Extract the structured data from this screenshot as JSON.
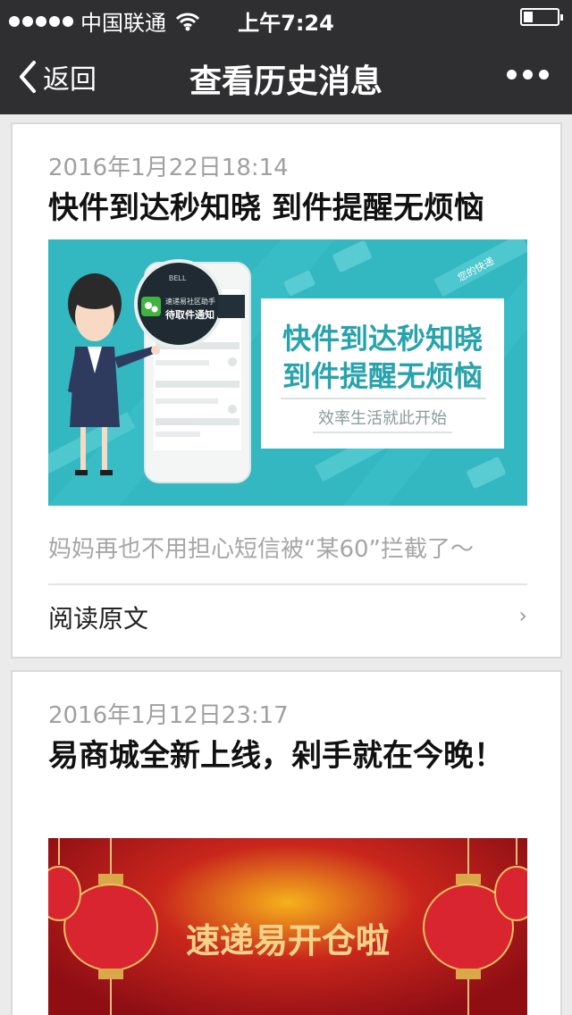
{
  "status": {
    "carrier": "中国联通",
    "time": "上午7:24",
    "battery_level": 0.28
  },
  "nav": {
    "back_label": "返回",
    "title": "查看历史消息"
  },
  "articles": [
    {
      "date": "2016年1月22日18:14",
      "title": "快件到达秒知晓 到件提醒无烦恼",
      "banner": {
        "phone_header": "BELL",
        "bubble_line1": "速递易社区助手",
        "bubble_line2": "待取件通知",
        "headline1": "快件到达秒知晓",
        "headline2": "到件提醒无烦恼",
        "slogan": "效率生活就此开始",
        "ticket_text": "您的快递"
      },
      "summary": "妈妈再也不用担心短信被“某60”拦截了～",
      "read_more": "阅读原文"
    },
    {
      "date": "2016年1月12日23:17",
      "title": "易商城全新上线，剁手就在今晚！",
      "banner": {
        "headline": "速递易开仓啦"
      }
    }
  ],
  "colors": {
    "navbar": "#2f2f31",
    "banner1_bg": "#33b7c0",
    "banner1_text": "#28a3ad",
    "banner2_bg": "#a8121a",
    "lantern": "#d8252f"
  }
}
